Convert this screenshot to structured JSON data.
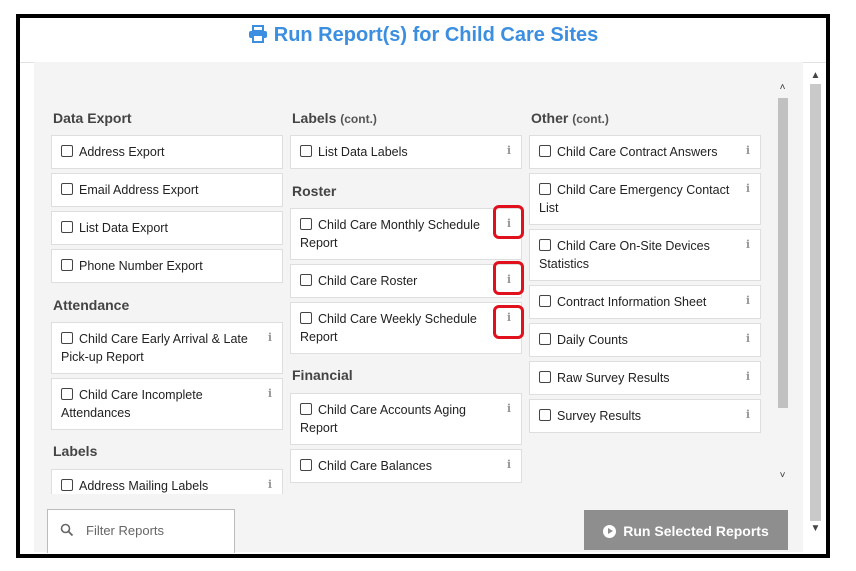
{
  "title": "Run Report(s) for Child Care Sites",
  "columns": [
    {
      "sections": [
        {
          "heading": "Data Export",
          "cont": "",
          "items": [
            "Address Export",
            "Email Address Export",
            "List Data Export",
            "Phone Number Export"
          ]
        },
        {
          "heading": "Attendance",
          "cont": "",
          "items": [
            "Child Care Early Arrival & Late Pick-up Report",
            "Child Care Incomplete Attendances"
          ]
        },
        {
          "heading": "Labels",
          "cont": "",
          "items": [
            "Address Mailing Labels"
          ]
        }
      ]
    },
    {
      "sections": [
        {
          "heading": "Labels",
          "cont": "(cont.)",
          "items": [
            "List Data Labels"
          ]
        },
        {
          "heading": "Roster",
          "cont": "",
          "items": [
            "Child Care Monthly Schedule Report",
            "Child Care Roster",
            "Child Care Weekly Schedule Report"
          ]
        },
        {
          "heading": "Financial",
          "cont": "",
          "items": [
            "Child Care Accounts Aging Report",
            "Child Care Balances"
          ]
        }
      ]
    },
    {
      "sections": [
        {
          "heading": "Other",
          "cont": "(cont.)",
          "items": [
            "Child Care Contract Answers",
            "Child Care Emergency Contact List",
            "Child Care On-Site Devices Statistics",
            "Contract Information Sheet",
            "Daily Counts",
            "Raw Survey Results",
            "Survey Results"
          ]
        }
      ]
    }
  ],
  "info_glyph": "i",
  "filter": {
    "placeholder": "Filter Reports"
  },
  "run_button": {
    "label": "Run Selected Reports"
  },
  "colors": {
    "accent": "#3b8ee0",
    "highlight": "#e0101d",
    "button": "#8e8e8e"
  },
  "icons": {
    "title": "printer-icon",
    "filter": "search-icon",
    "button": "play-circle-icon",
    "item": "info-icon"
  }
}
